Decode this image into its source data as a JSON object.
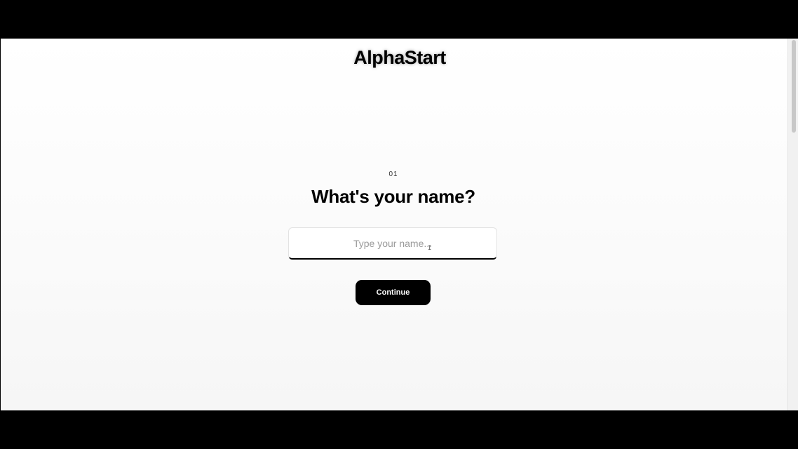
{
  "brand": {
    "logo_text": "AlphaStart"
  },
  "form": {
    "step_number": "01",
    "question": "What's your name?",
    "name_input": {
      "value": "",
      "placeholder": "Type your name..."
    },
    "continue_label": "Continue"
  },
  "icons": {
    "text_cursor": "text-cursor-icon"
  },
  "colors": {
    "button_bg": "#000000",
    "button_text": "#ffffff",
    "background": "#ffffff"
  }
}
